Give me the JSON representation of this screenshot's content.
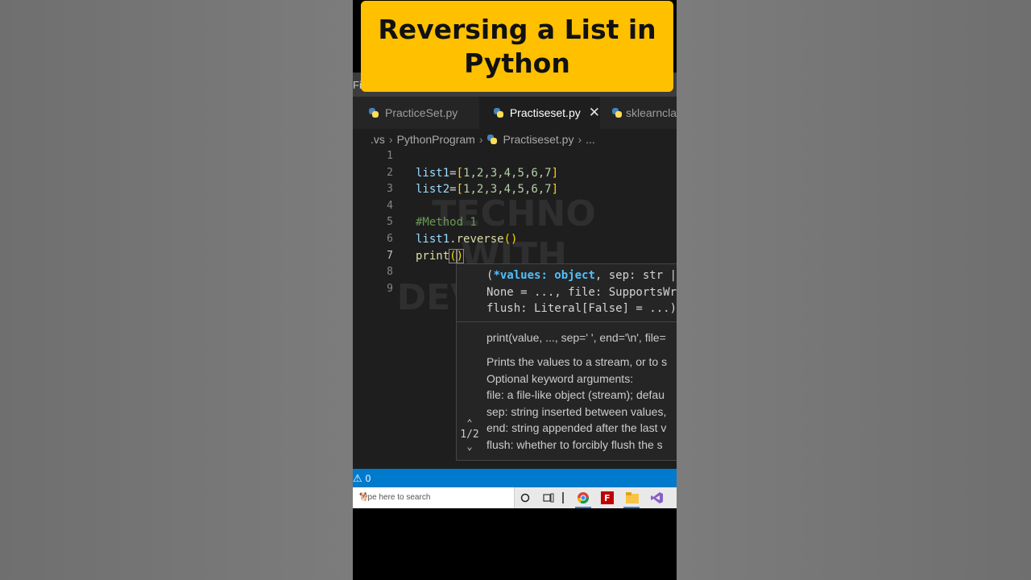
{
  "title": "Reversing a List in\nPython",
  "menu": {
    "partial_label": "Fi"
  },
  "tabs": [
    {
      "label": "PracticeSet.py",
      "icon": "python-icon",
      "active": false
    },
    {
      "label": "Practiseset.py",
      "icon": "python-icon",
      "active": true,
      "close": "✕"
    },
    {
      "label": "sklearncla",
      "icon": "python-icon",
      "active": false
    }
  ],
  "breadcrumb": [
    ".vs",
    "PythonProgram",
    "Practiseset.py",
    "..."
  ],
  "line_numbers": [
    "1",
    "2",
    "3",
    "4",
    "5",
    "6",
    "7",
    "8",
    "9"
  ],
  "current_line": "7",
  "code": {
    "line2": {
      "var": "list1",
      "op": "=",
      "open": "[",
      "nums": "1,2,3,4,5,6,7",
      "close": "]"
    },
    "line3": {
      "var": "list2",
      "op": "=",
      "open": "[",
      "nums": "1,2,3,4,5,6,7",
      "close": "]"
    },
    "line5": {
      "comment": "#Method 1"
    },
    "line6": {
      "obj": "list1",
      "dot": ".",
      "method": "reverse",
      "parens": "()"
    },
    "line7": {
      "func": "print",
      "open": "(",
      "close": ")"
    }
  },
  "watermark": "TECHNO\nWITH\nDEVELOPER",
  "hover": {
    "sig_open": "(",
    "sig_kw": "*values: object",
    "sig_rest1": ", sep: str |",
    "sig_line2": "None = ..., file: SupportsWri",
    "sig_line3": "flush: Literal[False] = ...)",
    "doc_signature": "print(value, ..., sep=' ', end='\\n', file=",
    "doc_lines": [
      "Prints the values to a stream, or to s",
      "Optional keyword arguments:",
      "file: a file-like object (stream); defau",
      "sep: string inserted between values,",
      "end: string appended after the last v",
      "flush: whether to forcibly flush the s"
    ],
    "pager": "1/2",
    "pager_up": "⌃",
    "pager_down": "⌄"
  },
  "status": {
    "warning_icon": "⚠",
    "warnings": "0"
  },
  "taskbar": {
    "search_placeholder": "Type here to search",
    "icons": [
      "cortana-circle-icon",
      "task-view-icon",
      "chrome-icon",
      "filezilla-icon",
      "file-explorer-icon",
      "visual-studio-icon"
    ]
  },
  "colors": {
    "banner": "#ffc000",
    "statusbar": "#007acc",
    "editor_bg": "#1e1e1e"
  }
}
